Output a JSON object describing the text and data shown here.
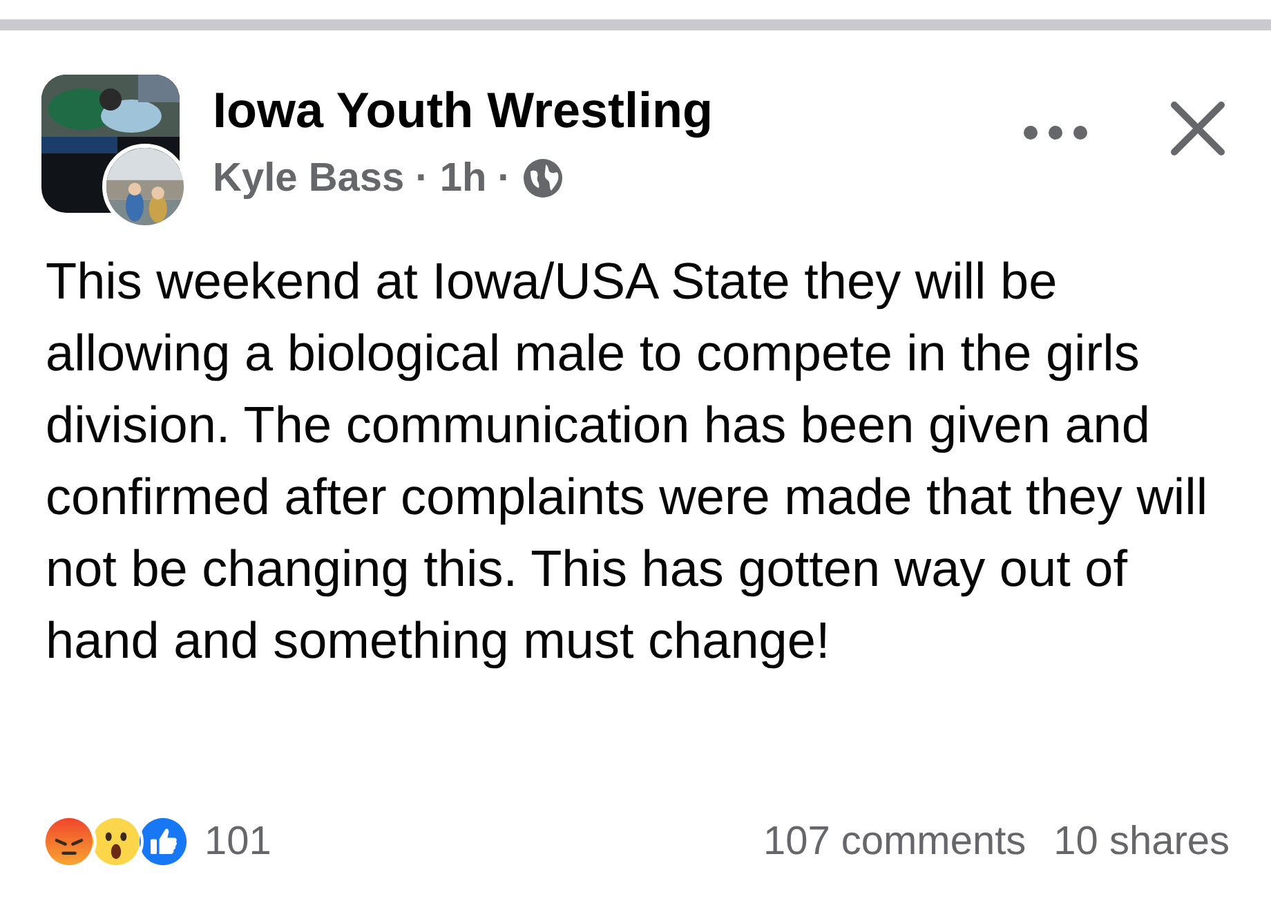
{
  "post": {
    "page_name": "Iowa Youth Wrestling",
    "meta": [
      {
        "kind": "text",
        "text": "Kyle Bass"
      },
      {
        "kind": "text",
        "text": "·"
      },
      {
        "kind": "text",
        "text": "1h"
      },
      {
        "kind": "text",
        "text": "·"
      },
      {
        "kind": "globe"
      }
    ],
    "body": "This weekend at Iowa/USA State they will be allowing a biological male to compete in the girls division. The communication has been given and confirmed after complaints were made that they will not be changing this. This has gotten way out of hand and something must change!",
    "reactions": [
      {
        "kind": "angry"
      },
      {
        "kind": "wow"
      },
      {
        "kind": "like"
      }
    ],
    "reaction_count": "101",
    "comments": "107 comments",
    "shares": "10 shares"
  }
}
